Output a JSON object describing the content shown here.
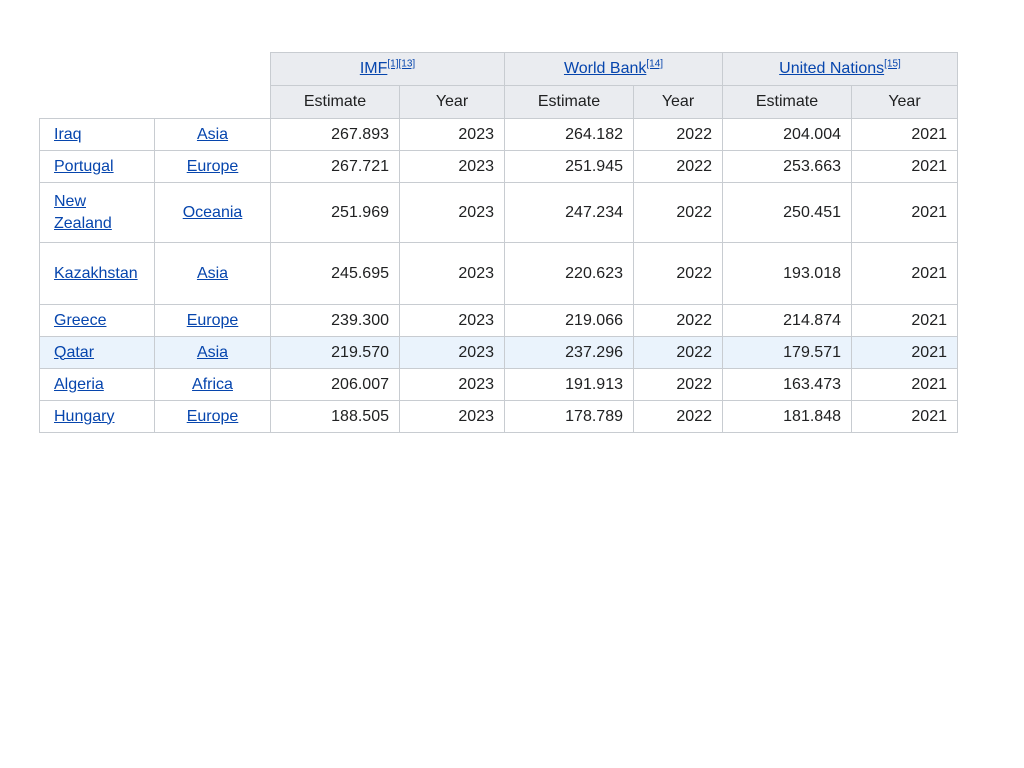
{
  "header": {
    "sources": [
      {
        "label": "IMF",
        "refs": "[1][13]"
      },
      {
        "label": "World Bank",
        "refs": "[14]"
      },
      {
        "label": "United Nations",
        "refs": "[15]"
      }
    ],
    "sub": [
      "Estimate",
      "Year",
      "Estimate",
      "Year",
      "Estimate",
      "Year"
    ]
  },
  "rows": [
    {
      "country": "Iraq",
      "region": "Asia",
      "imf_est": "267.893",
      "imf_year": "2023",
      "wb_est": "264.182",
      "wb_year": "2022",
      "un_est": "204.004",
      "un_year": "2021"
    },
    {
      "country": "Portugal",
      "region": "Europe",
      "imf_est": "267.721",
      "imf_year": "2023",
      "wb_est": "251.945",
      "wb_year": "2022",
      "un_est": "253.663",
      "un_year": "2021"
    },
    {
      "country": "New Zealand",
      "region": "Oceania",
      "imf_est": "251.969",
      "imf_year": "2023",
      "wb_est": "247.234",
      "wb_year": "2022",
      "un_est": "250.451",
      "un_year": "2021"
    },
    {
      "country": "Kazakhstan",
      "region": "Asia",
      "imf_est": "245.695",
      "imf_year": "2023",
      "wb_est": "220.623",
      "wb_year": "2022",
      "un_est": "193.018",
      "un_year": "2021"
    },
    {
      "country": "Greece",
      "region": "Europe",
      "imf_est": "239.300",
      "imf_year": "2023",
      "wb_est": "219.066",
      "wb_year": "2022",
      "un_est": "214.874",
      "un_year": "2021"
    },
    {
      "country": "Qatar",
      "region": "Asia",
      "imf_est": "219.570",
      "imf_year": "2023",
      "wb_est": "237.296",
      "wb_year": "2022",
      "un_est": "179.571",
      "un_year": "2021"
    },
    {
      "country": "Algeria",
      "region": "Africa",
      "imf_est": "206.007",
      "imf_year": "2023",
      "wb_est": "191.913",
      "wb_year": "2022",
      "un_est": "163.473",
      "un_year": "2021"
    },
    {
      "country": "Hungary",
      "region": "Europe",
      "imf_est": "188.505",
      "imf_year": "2023",
      "wb_est": "178.789",
      "wb_year": "2022",
      "un_est": "181.848",
      "un_year": "2021"
    }
  ]
}
